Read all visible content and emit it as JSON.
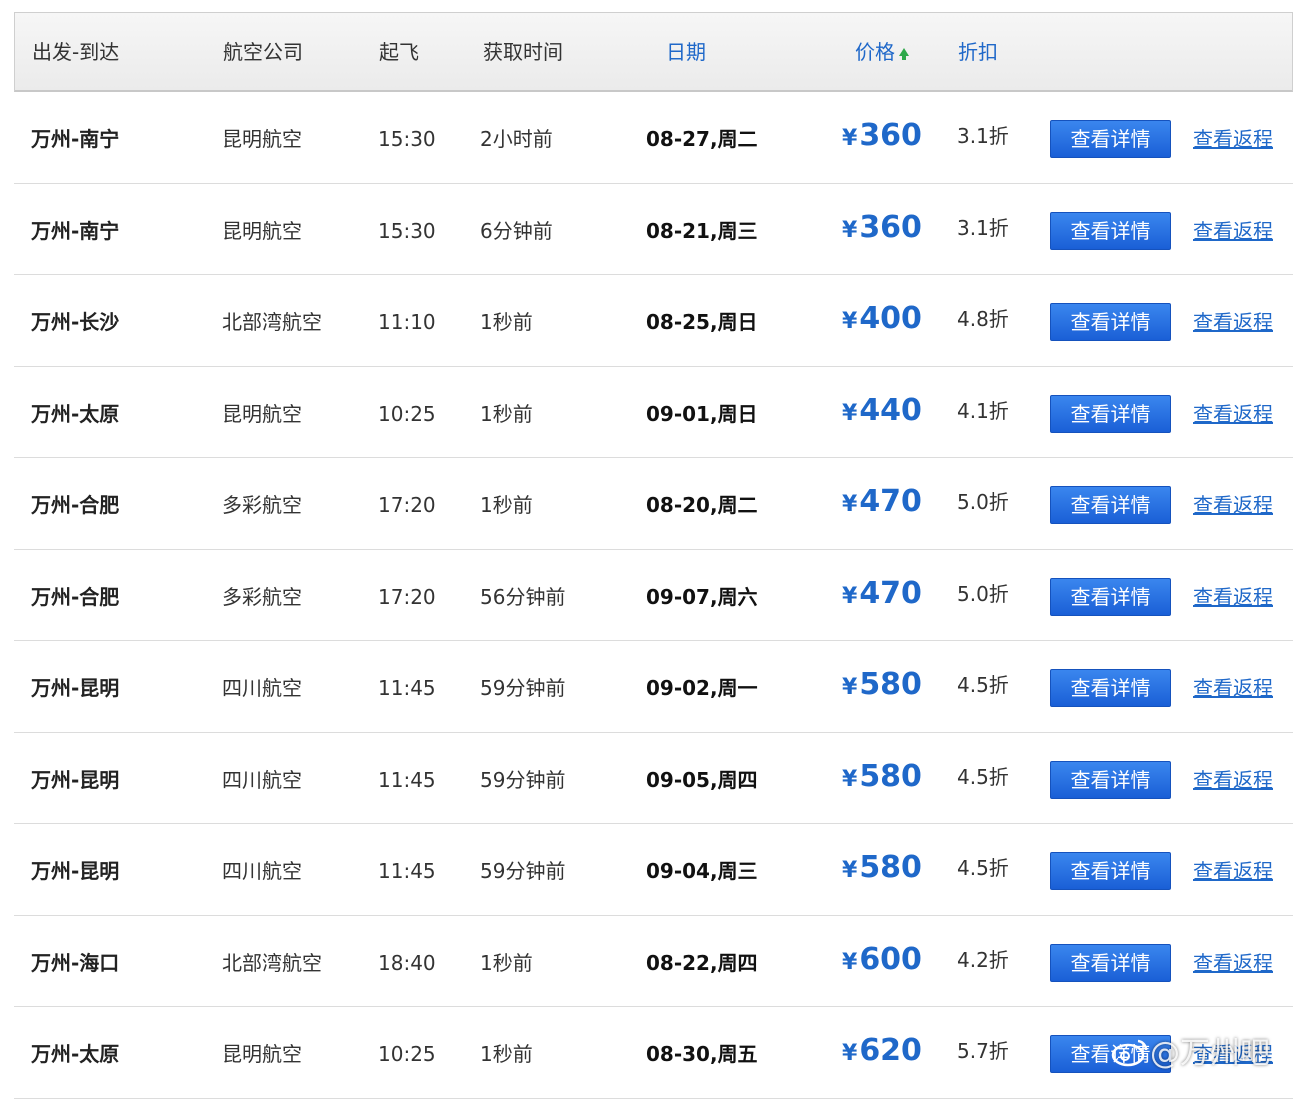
{
  "headers": {
    "route": "出发-到达",
    "airline": "航空公司",
    "departure": "起飞",
    "fetched": "获取时间",
    "date": "日期",
    "price": "价格",
    "discount": "折扣"
  },
  "sort": {
    "column": "price",
    "icon": "sort-up-arrow-icon",
    "color": "#2ea84a"
  },
  "colors": {
    "accent": "#1f68c9",
    "button": "#1a5fd6"
  },
  "rows": [
    {
      "route": "万州-南宁",
      "airline": "昆明航空",
      "dep": "15:30",
      "fetched": "2小时前",
      "date": "08-27,周二",
      "yen": "¥",
      "price": "360",
      "discount": "3.1折",
      "detail": "查看详情",
      "ret": "查看返程"
    },
    {
      "route": "万州-南宁",
      "airline": "昆明航空",
      "dep": "15:30",
      "fetched": "6分钟前",
      "date": "08-21,周三",
      "yen": "¥",
      "price": "360",
      "discount": "3.1折",
      "detail": "查看详情",
      "ret": "查看返程"
    },
    {
      "route": "万州-长沙",
      "airline": "北部湾航空",
      "dep": "11:10",
      "fetched": "1秒前",
      "date": "08-25,周日",
      "yen": "¥",
      "price": "400",
      "discount": "4.8折",
      "detail": "查看详情",
      "ret": "查看返程"
    },
    {
      "route": "万州-太原",
      "airline": "昆明航空",
      "dep": "10:25",
      "fetched": "1秒前",
      "date": "09-01,周日",
      "yen": "¥",
      "price": "440",
      "discount": "4.1折",
      "detail": "查看详情",
      "ret": "查看返程"
    },
    {
      "route": "万州-合肥",
      "airline": "多彩航空",
      "dep": "17:20",
      "fetched": "1秒前",
      "date": "08-20,周二",
      "yen": "¥",
      "price": "470",
      "discount": "5.0折",
      "detail": "查看详情",
      "ret": "查看返程"
    },
    {
      "route": "万州-合肥",
      "airline": "多彩航空",
      "dep": "17:20",
      "fetched": "56分钟前",
      "date": "09-07,周六",
      "yen": "¥",
      "price": "470",
      "discount": "5.0折",
      "detail": "查看详情",
      "ret": "查看返程"
    },
    {
      "route": "万州-昆明",
      "airline": "四川航空",
      "dep": "11:45",
      "fetched": "59分钟前",
      "date": "09-02,周一",
      "yen": "¥",
      "price": "580",
      "discount": "4.5折",
      "detail": "查看详情",
      "ret": "查看返程"
    },
    {
      "route": "万州-昆明",
      "airline": "四川航空",
      "dep": "11:45",
      "fetched": "59分钟前",
      "date": "09-05,周四",
      "yen": "¥",
      "price": "580",
      "discount": "4.5折",
      "detail": "查看详情",
      "ret": "查看返程"
    },
    {
      "route": "万州-昆明",
      "airline": "四川航空",
      "dep": "11:45",
      "fetched": "59分钟前",
      "date": "09-04,周三",
      "yen": "¥",
      "price": "580",
      "discount": "4.5折",
      "detail": "查看详情",
      "ret": "查看返程"
    },
    {
      "route": "万州-海口",
      "airline": "北部湾航空",
      "dep": "18:40",
      "fetched": "1秒前",
      "date": "08-22,周四",
      "yen": "¥",
      "price": "600",
      "discount": "4.2折",
      "detail": "查看详情",
      "ret": "查看返程"
    },
    {
      "route": "万州-太原",
      "airline": "昆明航空",
      "dep": "10:25",
      "fetched": "1秒前",
      "date": "08-30,周五",
      "yen": "¥",
      "price": "620",
      "discount": "5.7折",
      "detail": "查看详情",
      "ret": "查看返程"
    }
  ],
  "watermark": {
    "text": "@万州吧",
    "icon": "weibo-logo-icon"
  }
}
